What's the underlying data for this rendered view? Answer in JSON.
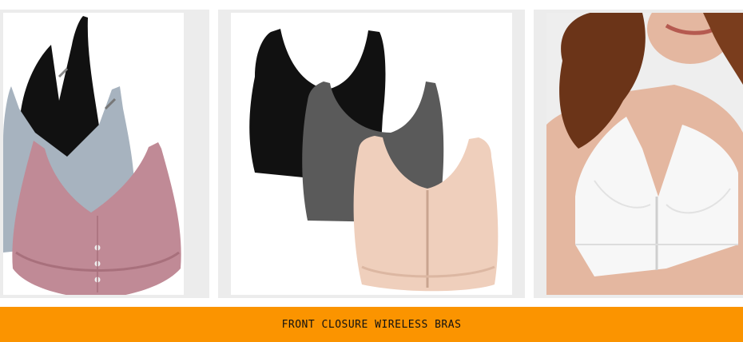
{
  "colors": {
    "banner": "#fb9400",
    "card_border": "#ececec",
    "black_bra": "#111111",
    "grey_bra": "#a7b3bf",
    "pink_bra": "#c08a96",
    "heather_bra": "#5a5a5a",
    "nude_bra": "#efcfbc",
    "white_bra": "#f7f7f7",
    "skin": "#e4b7a0",
    "hair": "#6b3418"
  },
  "products": [
    {
      "image": "three-pack-button-front-bras-icon"
    },
    {
      "image": "three-pack-zip-front-racerback-bras-icon"
    },
    {
      "image": "white-lace-front-closure-bra-model-icon"
    }
  ],
  "banner": {
    "text": "FRONT CLOSURE WIRELESS BRAS"
  }
}
